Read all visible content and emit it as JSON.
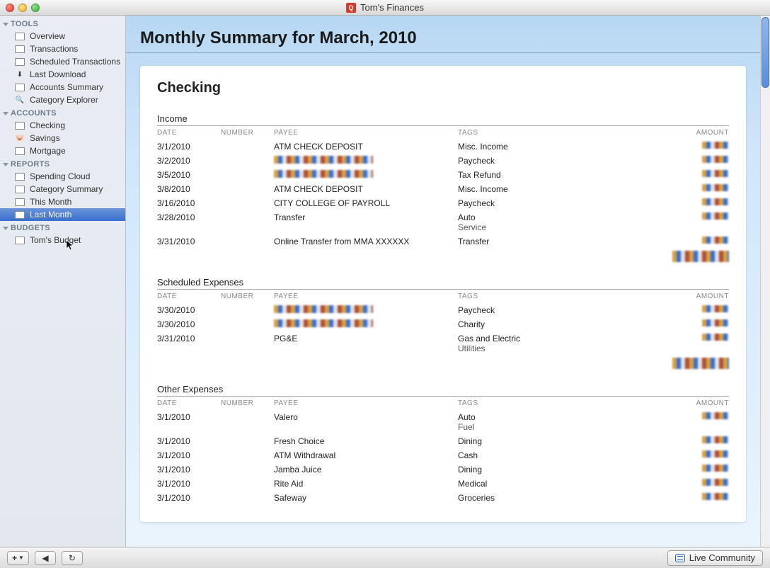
{
  "window": {
    "title": "Tom's Finances"
  },
  "sidebar": {
    "sections": [
      {
        "header": "TOOLS",
        "items": [
          {
            "label": "Overview",
            "icon": "overview-icon"
          },
          {
            "label": "Transactions",
            "icon": "transactions-icon"
          },
          {
            "label": "Scheduled Transactions",
            "icon": "scheduled-icon"
          },
          {
            "label": "Last Download",
            "icon": "download-icon"
          },
          {
            "label": "Accounts Summary",
            "icon": "summary-icon"
          },
          {
            "label": "Category Explorer",
            "icon": "search-icon"
          }
        ]
      },
      {
        "header": "ACCOUNTS",
        "items": [
          {
            "label": "Checking",
            "icon": "checking-icon"
          },
          {
            "label": "Savings",
            "icon": "savings-icon"
          },
          {
            "label": "Mortgage",
            "icon": "mortgage-icon"
          }
        ]
      },
      {
        "header": "REPORTS",
        "items": [
          {
            "label": "Spending Cloud",
            "icon": "report-icon"
          },
          {
            "label": "Category Summary",
            "icon": "report-icon"
          },
          {
            "label": "This Month",
            "icon": "report-icon"
          },
          {
            "label": "Last Month",
            "icon": "report-icon",
            "selected": true
          }
        ]
      },
      {
        "header": "BUDGETS",
        "items": [
          {
            "label": "Tom's Budget",
            "icon": "budget-icon"
          }
        ]
      }
    ]
  },
  "page": {
    "title": "Monthly Summary for March, 2010",
    "account_heading": "Checking",
    "columns": {
      "date": "DATE",
      "number": "NUMBER",
      "payee": "PAYEE",
      "tags": "TAGS",
      "amount": "AMOUNT"
    },
    "sections": [
      {
        "title": "Income",
        "rows": [
          {
            "date": "3/1/2010",
            "number": "",
            "payee": "ATM CHECK DEPOSIT",
            "tags": [
              "Misc. Income"
            ],
            "amount_obscured": true
          },
          {
            "date": "3/2/2010",
            "number": "",
            "payee_obscured": true,
            "tags": [
              "Paycheck"
            ],
            "amount_obscured": true
          },
          {
            "date": "3/5/2010",
            "number": "",
            "payee_obscured": true,
            "tags": [
              "Tax Refund"
            ],
            "amount_obscured": true
          },
          {
            "date": "3/8/2010",
            "number": "",
            "payee": "ATM CHECK DEPOSIT",
            "tags": [
              "Misc. Income"
            ],
            "amount_obscured": true
          },
          {
            "date": "3/16/2010",
            "number": "",
            "payee": "CITY COLLEGE OF PAYROLL",
            "tags": [
              "Paycheck"
            ],
            "amount_obscured": true
          },
          {
            "date": "3/28/2010",
            "number": "",
            "payee": "Transfer",
            "tags": [
              "Auto",
              "Service"
            ],
            "amount_obscured": true
          },
          {
            "date": "3/31/2010",
            "number": "",
            "payee": "Online Transfer from MMA XXXXXX",
            "tags": [
              "Transfer"
            ],
            "amount_obscured": true
          }
        ],
        "has_total": true
      },
      {
        "title": "Scheduled Expenses",
        "rows": [
          {
            "date": "3/30/2010",
            "number": "",
            "payee_obscured": true,
            "tags": [
              "Paycheck"
            ],
            "amount_obscured": true
          },
          {
            "date": "3/30/2010",
            "number": "",
            "payee_obscured": true,
            "tags": [
              "Charity"
            ],
            "amount_obscured": true
          },
          {
            "date": "3/31/2010",
            "number": "",
            "payee": "PG&E",
            "tags": [
              "Gas and Electric",
              "Utilities"
            ],
            "amount_obscured": true
          }
        ],
        "has_total": true
      },
      {
        "title": "Other Expenses",
        "rows": [
          {
            "date": "3/1/2010",
            "number": "",
            "payee": "Valero",
            "tags": [
              "Auto",
              "Fuel"
            ],
            "amount_obscured": true
          },
          {
            "date": "3/1/2010",
            "number": "",
            "payee": "Fresh Choice",
            "tags": [
              "Dining"
            ],
            "amount_obscured": true
          },
          {
            "date": "3/1/2010",
            "number": "",
            "payee": "ATM Withdrawal",
            "tags": [
              "Cash"
            ],
            "amount_obscured": true
          },
          {
            "date": "3/1/2010",
            "number": "",
            "payee": "Jamba Juice",
            "tags": [
              "Dining"
            ],
            "amount_obscured": true
          },
          {
            "date": "3/1/2010",
            "number": "",
            "payee": "Rite Aid",
            "tags": [
              "Medical"
            ],
            "amount_obscured": true
          },
          {
            "date": "3/1/2010",
            "number": "",
            "payee": "Safeway",
            "tags": [
              "Groceries"
            ],
            "amount_obscured": true
          }
        ],
        "has_total": false
      }
    ]
  },
  "footer": {
    "add_label": "+",
    "back_label": "◀",
    "refresh_label": "↻",
    "live_community": "Live Community"
  }
}
